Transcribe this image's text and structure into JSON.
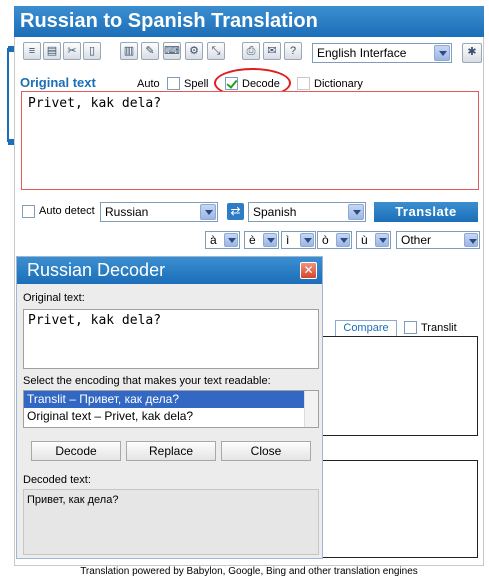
{
  "app": {
    "title": "Russian to Spanish Translation"
  },
  "toolbar": {
    "icons": [
      "notepad-icon",
      "print-icon",
      "cut-icon",
      "trash-icon",
      "book-icon",
      "spellcheck-icon",
      "keyboard-icon",
      "tools-icon",
      "resize-icon",
      "printer-icon",
      "mail-icon",
      "help-icon"
    ],
    "interface_select": "English Interface"
  },
  "options": {
    "original_text_label": "Original text",
    "auto_label": "Auto",
    "spell_label": "Spell",
    "decode_label": "Decode",
    "dictionary_label": "Dictionary",
    "decode_checked": true
  },
  "input": {
    "text": "Privet, kak dela?"
  },
  "languages": {
    "auto_detect_label": "Auto detect",
    "source": "Russian",
    "target": "Spanish",
    "translate_label": "Translate",
    "swap_symbol": "⇄"
  },
  "accents": [
    "à",
    "è",
    "ì",
    "ò",
    "ù"
  ],
  "other_select": "Other",
  "output_panel": {
    "compare_tab": "Compare",
    "translit_label": "Translit"
  },
  "dialog": {
    "title": "Russian Decoder",
    "close_symbol": "✕",
    "original_label": "Original text:",
    "original_text": "Privet, kak dela?",
    "encoding_prompt": "Select the encoding that makes your text readable:",
    "encodings": [
      "Translit – Привет, как дела?",
      "Original text – Privet, kak dela?"
    ],
    "selected_index": 0,
    "decode_label": "Decode",
    "replace_label": "Replace",
    "close_label": "Close",
    "decoded_label": "Decoded text:",
    "decoded_text": "Привет, как дела?"
  },
  "footer": {
    "text": "Translation powered by Babylon, Google, Bing and other translation engines"
  },
  "colors": {
    "accent": "#1b6eb8",
    "highlight_oval": "#e21d1d",
    "selection": "#3268c4"
  }
}
